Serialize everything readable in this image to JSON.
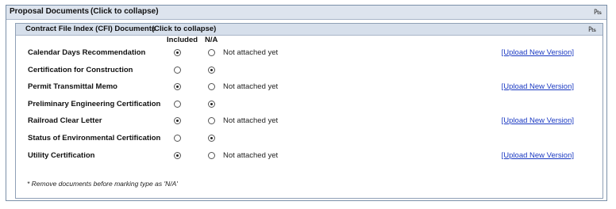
{
  "proposal": {
    "title": "Proposal Documents",
    "collapse_hint": "(Click to collapse)",
    "pin_icon": "pin-icon"
  },
  "cfi": {
    "title": "Contract File Index (CFI) Documents",
    "collapse_hint": "(Click to collapse)",
    "pin_icon": "pin-icon",
    "columns": {
      "included": "Included",
      "na": "N/A"
    },
    "rows": [
      {
        "label": "Calendar Days Recommendation",
        "selected": "included",
        "status": "Not attached yet",
        "link": "[Upload New Version]"
      },
      {
        "label": "Certification for Construction",
        "selected": "na",
        "status": "",
        "link": ""
      },
      {
        "label": "Permit Transmittal Memo",
        "selected": "included",
        "status": "Not attached yet",
        "link": "[Upload New Version]"
      },
      {
        "label": "Preliminary Engineering Certification",
        "selected": "na",
        "status": "",
        "link": ""
      },
      {
        "label": "Railroad Clear Letter",
        "selected": "included",
        "status": "Not attached yet",
        "link": "[Upload New Version]"
      },
      {
        "label": "Status of Environmental Certification",
        "selected": "na",
        "status": "",
        "link": ""
      },
      {
        "label": "Utility Certification",
        "selected": "included",
        "status": "Not attached yet",
        "link": "[Upload New Version]"
      }
    ],
    "footnote": "* Remove documents before marking type as 'N/A'"
  },
  "colors": {
    "header_bg": "#dde4ee",
    "inner_header_bg": "#d6dfeb",
    "link": "#1a39c2",
    "border": "#7a8fa8"
  }
}
